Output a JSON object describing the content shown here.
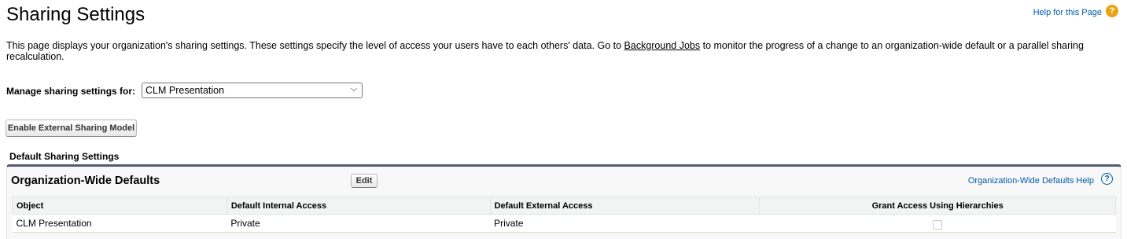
{
  "header": {
    "title": "Sharing Settings",
    "help_link": "Help for this Page",
    "help_icon": "?"
  },
  "description": {
    "before": "This page displays your organization's sharing settings. These settings specify the level of access your users have to each others' data. Go to ",
    "link": "Background Jobs",
    "after": " to monitor the progress of a change to an organization-wide default or a parallel sharing recalculation."
  },
  "manage": {
    "label": "Manage sharing settings for:",
    "selected": "CLM Presentation"
  },
  "buttons": {
    "enable_external": "Enable External Sharing Model",
    "edit": "Edit"
  },
  "section": {
    "heading": "Default Sharing Settings"
  },
  "panel": {
    "title": "Organization-Wide Defaults",
    "help_link": "Organization-Wide Defaults Help",
    "help_icon": "?",
    "columns": [
      "Object",
      "Default Internal Access",
      "Default External Access",
      "Grant Access Using Hierarchies"
    ],
    "rows": [
      {
        "object": "CLM Presentation",
        "internal": "Private",
        "external": "Private",
        "grant_hierarchies": false
      }
    ]
  }
}
